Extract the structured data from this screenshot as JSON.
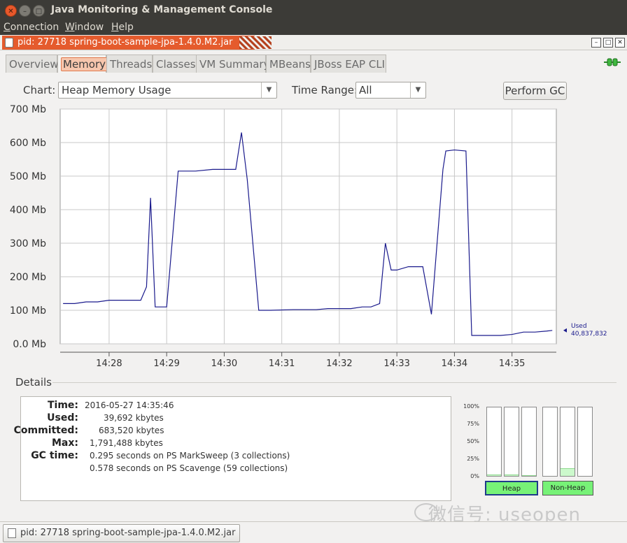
{
  "window": {
    "title": "Java Monitoring & Management Console",
    "close_glyph": "✕",
    "min_glyph": "–",
    "max_glyph": "□"
  },
  "menu": {
    "items": [
      {
        "label": "Connection",
        "mnemonic": "C",
        "rest": "onnection"
      },
      {
        "label": "Window",
        "mnemonic": "W",
        "rest": "indow"
      },
      {
        "label": "Help",
        "mnemonic": "H",
        "rest": "elp"
      }
    ]
  },
  "connection_frame": {
    "title": "pid: 27718 spring-boot-sample-jpa-1.4.0.M2.jar",
    "ctrl_min": "–",
    "ctrl_max": "□",
    "ctrl_close": "✕"
  },
  "tabs": [
    "Overview",
    "Memory",
    "Threads",
    "Classes",
    "VM Summary",
    "MBeans",
    "JBoss EAP CLI"
  ],
  "active_tab": "Memory",
  "controls": {
    "chart_label": "Chart:",
    "chart_value": "Heap Memory Usage",
    "time_range_label": "Time Range:",
    "time_range_value": "All",
    "perform_gc": "Perform GC",
    "arrow": "▼"
  },
  "chart_data": {
    "type": "line",
    "ylim": [
      0,
      700
    ],
    "yticks": [
      "0.0 Mb",
      "100 Mb",
      "200 Mb",
      "300 Mb",
      "400 Mb",
      "500 Mb",
      "600 Mb",
      "700 Mb"
    ],
    "xticks": [
      "14:28",
      "14:29",
      "14:30",
      "14:31",
      "14:32",
      "14:33",
      "14:34",
      "14:35"
    ],
    "xlim": [
      27.15,
      35.77
    ],
    "series": [
      {
        "name": "Used",
        "value_label": "40,837,832",
        "color": "#1a1a8c",
        "x": [
          27.2,
          27.4,
          27.6,
          27.8,
          28.0,
          28.2,
          28.38,
          28.45,
          28.55,
          28.65,
          28.72,
          28.8,
          29.0,
          29.2,
          29.4,
          29.5,
          29.8,
          30.0,
          30.1,
          30.2,
          30.3,
          30.4,
          30.6,
          30.8,
          31.2,
          31.4,
          31.6,
          31.8,
          32.0,
          32.2,
          32.4,
          32.45,
          32.5,
          32.55,
          32.7,
          32.8,
          32.9,
          33.0,
          33.2,
          33.35,
          33.45,
          33.6,
          33.8,
          33.85,
          34.0,
          34.2,
          34.3,
          34.4,
          34.6,
          34.8,
          35.0,
          35.2,
          35.4,
          35.6,
          35.7
        ],
        "y": [
          120,
          120,
          125,
          125,
          130,
          130,
          130,
          130,
          130,
          170,
          435,
          110,
          110,
          515,
          515,
          515,
          520,
          520,
          520,
          520,
          630,
          490,
          100,
          100,
          102,
          102,
          102,
          105,
          105,
          105,
          110,
          110,
          110,
          110,
          120,
          300,
          220,
          220,
          230,
          230,
          230,
          88,
          520,
          575,
          578,
          575,
          25,
          25,
          25,
          25,
          28,
          35,
          35,
          38,
          40
        ]
      }
    ],
    "legend_position": "right"
  },
  "details": {
    "title": "Details",
    "rows": [
      {
        "label": "Time:",
        "value": "2016-05-27 14:35:46"
      },
      {
        "label": "Used:",
        "value": "39,692 kbytes"
      },
      {
        "label": "Committed:",
        "value": "683,520 kbytes"
      },
      {
        "label": "Max:",
        "value": "1,791,488 kbytes"
      },
      {
        "label": "GC time:",
        "value": "0.295  seconds on PS MarkSweep (3 collections)"
      },
      {
        "label": "",
        "value": "0.578  seconds on PS Scavenge (59 collections)"
      }
    ]
  },
  "pools": {
    "pct_labels": [
      "100%",
      "75%",
      "50%",
      "25%",
      "0%"
    ],
    "heap_fills": [
      0.02,
      0.02,
      0.01
    ],
    "nonheap_fills": [
      0.0,
      0.11,
      0.0
    ],
    "heap_label": "Heap",
    "nonheap_label": "Non-Heap"
  },
  "watermark": "微信号: useopen",
  "status": {
    "task_label": "pid: 27718 spring-boot-sample-jpa-1.4.0.M2.jar"
  }
}
